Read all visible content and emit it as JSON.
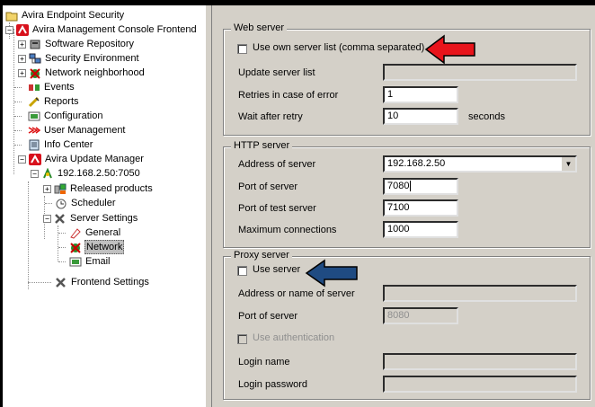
{
  "tree": {
    "root": "Avira Endpoint Security",
    "console": "Avira Management Console Frontend",
    "software_repository": "Software Repository",
    "security_environment": "Security Environment",
    "network_neighborhood": "Network neighborhood",
    "events": "Events",
    "reports": "Reports",
    "configuration": "Configuration",
    "user_management": "User Management",
    "info_center": "Info Center",
    "update_manager": "Avira Update Manager",
    "server_ip": "192.168.2.50:7050",
    "released_products": "Released products",
    "scheduler": "Scheduler",
    "server_settings": "Server Settings",
    "general": "General",
    "network": "Network",
    "email": "Email",
    "frontend_settings": "Frontend Settings"
  },
  "web_server": {
    "title": "Web server",
    "use_own_list": "Use own server list (comma separated)",
    "update_server_list_label": "Update server list",
    "update_server_list_value": "",
    "retries_label": "Retries in case of error",
    "retries_value": "1",
    "wait_label": "Wait after retry",
    "wait_value": "10",
    "wait_unit": "seconds"
  },
  "http_server": {
    "title": "HTTP server",
    "address_label": "Address of server",
    "address_value": "192.168.2.50",
    "port_label": "Port of server",
    "port_value": "7080",
    "test_port_label": "Port of test server",
    "test_port_value": "7100",
    "max_conn_label": "Maximum connections",
    "max_conn_value": "1000"
  },
  "proxy_server": {
    "title": "Proxy server",
    "use_server": "Use server",
    "address_label": "Address or name of server",
    "address_value": "",
    "port_label": "Port of server",
    "port_value": "8080",
    "use_auth": "Use authentication",
    "login_label": "Login name",
    "login_value": "",
    "password_label": "Login password",
    "password_value": ""
  },
  "colors": {
    "panel": "#d4d0c8",
    "red_arrow": "#e8141b",
    "blue_arrow": "#1f4b82",
    "avira_red": "#d8111c"
  }
}
